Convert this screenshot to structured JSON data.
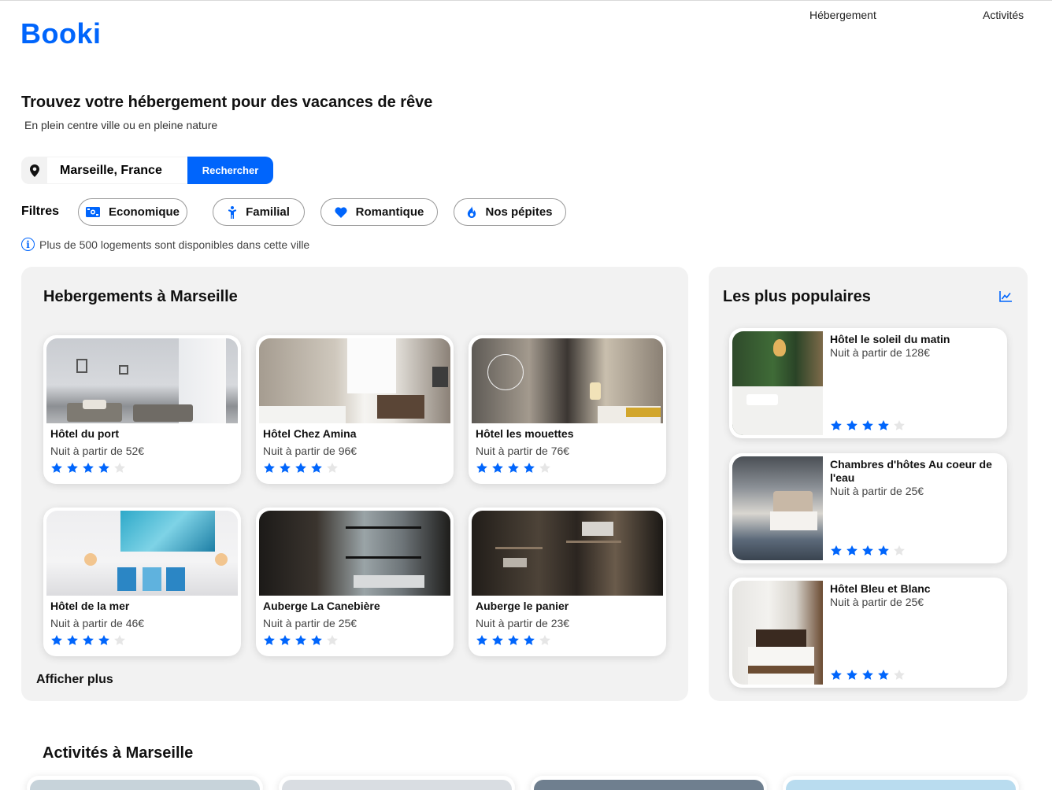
{
  "header": {
    "logo": "Booki",
    "nav": [
      "Hébergement",
      "Activités"
    ]
  },
  "hero": {
    "title": "Trouvez votre hébergement pour des vacances de rêve",
    "subtitle": "En plein centre ville ou en pleine nature"
  },
  "search": {
    "value": "Marseille, France",
    "button_label": "Rechercher"
  },
  "filters": {
    "label": "Filtres",
    "items": [
      {
        "label": "Economique",
        "icon": "money-bill-icon"
      },
      {
        "label": "Familial",
        "icon": "child-icon"
      },
      {
        "label": "Romantique",
        "icon": "heart-icon"
      },
      {
        "label": "Nos pépites",
        "icon": "fire-icon"
      }
    ]
  },
  "info": {
    "text": "Plus de 500 logements sont disponibles dans cette ville"
  },
  "listings": {
    "title": "Hebergements à Marseille",
    "more_label": "Afficher plus",
    "items": [
      {
        "name": "Hôtel du port",
        "price": "Nuit à partir de 52€",
        "rating": 4
      },
      {
        "name": "Hôtel Chez Amina",
        "price": "Nuit à partir de 96€",
        "rating": 4
      },
      {
        "name": "Hôtel les mouettes",
        "price": "Nuit à partir de 76€",
        "rating": 4
      },
      {
        "name": "Hôtel de la mer",
        "price": "Nuit à partir de 46€",
        "rating": 4
      },
      {
        "name": "Auberge La Canebière",
        "price": "Nuit à partir de 25€",
        "rating": 4
      },
      {
        "name": "Auberge le panier",
        "price": "Nuit à partir de 23€",
        "rating": 4
      }
    ]
  },
  "popular": {
    "title": "Les plus populaires",
    "icon": "chart-line-icon",
    "items": [
      {
        "name": "Hôtel le soleil du matin",
        "price": "Nuit à partir de 128€",
        "rating": 4
      },
      {
        "name": "Chambres d'hôtes Au coeur de l'eau",
        "price": "Nuit à partir de 25€",
        "rating": 4
      },
      {
        "name": "Hôtel Bleu et Blanc",
        "price": "Nuit à partir de 25€",
        "rating": 4
      }
    ]
  },
  "activities": {
    "title": "Activités à Marseille"
  },
  "colors": {
    "accent": "#0065fc",
    "panel": "#f2f2f2",
    "star_off": "#e6e6e6"
  }
}
